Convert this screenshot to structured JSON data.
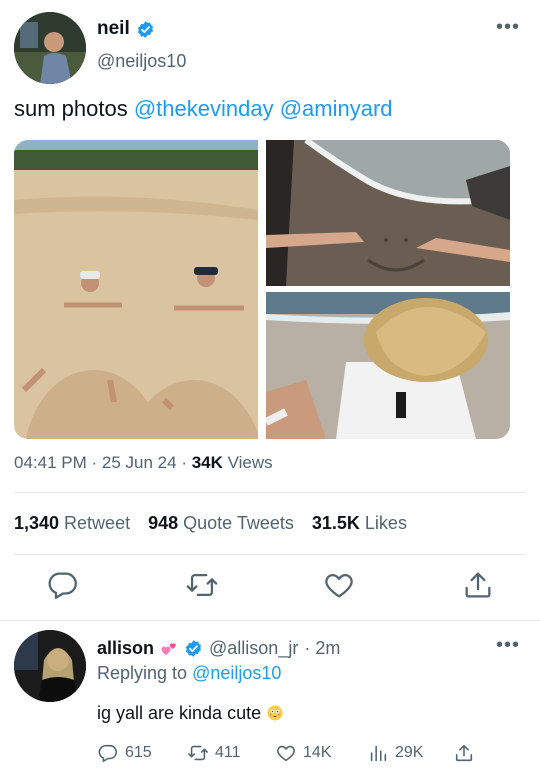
{
  "tweet": {
    "name": "neil",
    "handle": "@neiljos10",
    "more": "•••",
    "text_prefix": "sum photos ",
    "mention_1": "@thekevinday",
    "mention_2": "@aminyard",
    "time": "04:41 PM",
    "date": "25 Jun 24",
    "views_count": "34K",
    "views_label": "Views",
    "retweet_count": "1,340",
    "retweet_label": "Retweet",
    "quote_count": "948",
    "quote_label": "Quote Tweets",
    "likes_count": "31.5K",
    "likes_label": "Likes",
    "icons": {
      "avatar": "avatar-photo",
      "verified": "verified-badge-icon",
      "reply": "reply-icon",
      "retweet": "retweet-icon",
      "like": "heart-icon",
      "share": "share-icon"
    }
  },
  "reply": {
    "name": "allison",
    "handle": "@allison_jr",
    "time": "· 2m",
    "more": "•••",
    "replying_prefix": "Replying to",
    "replying_to": "@neiljos10",
    "text": "ig yall are kinda cute",
    "reply_count": "615",
    "retweet_count": "411",
    "like_count": "14K",
    "view_count": "29K"
  },
  "colors": {
    "accent": "#1d9bf0",
    "secondary_text": "#536471",
    "divider": "#e6e9ea"
  }
}
